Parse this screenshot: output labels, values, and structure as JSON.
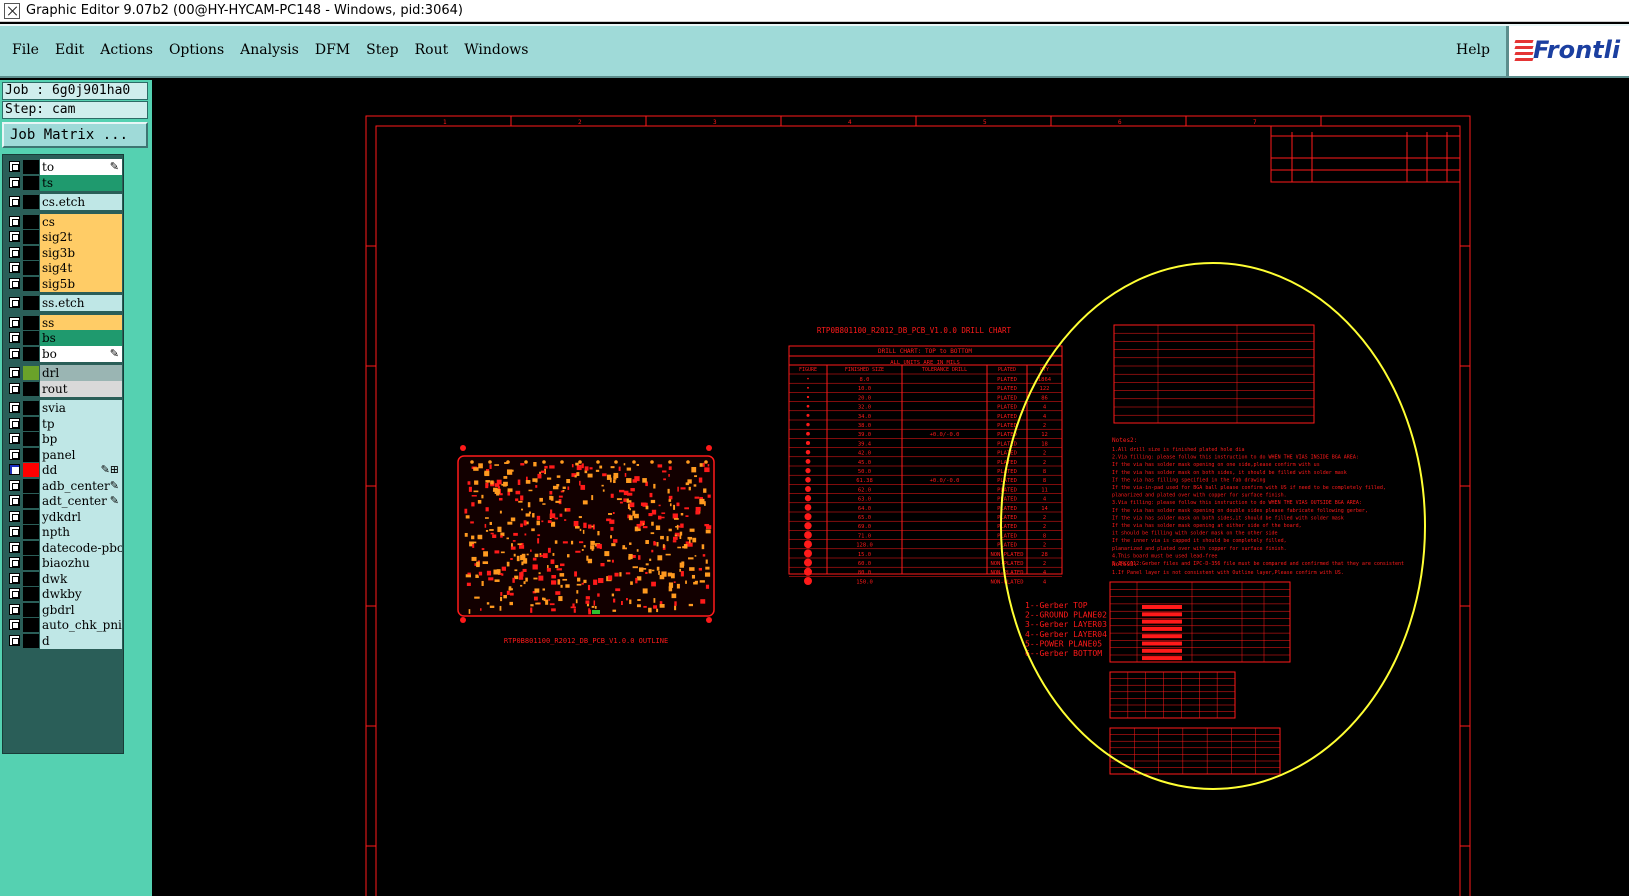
{
  "window": {
    "title": "Graphic Editor 9.07b2 (00@HY-HYCAM-PC148 - Windows, pid:3064)"
  },
  "menubar": {
    "items": [
      "File",
      "Edit",
      "Actions",
      "Options",
      "Analysis",
      "DFM",
      "Step",
      "Rout",
      "Windows"
    ],
    "help_label": "Help",
    "logo_text": "Frontli"
  },
  "job": {
    "label": "Job : 6g0j901ha0",
    "step": "Step: cam",
    "matrix_label": "Job Matrix ..."
  },
  "layers": [
    {
      "name": "to",
      "color": "#ffffff",
      "checked": false,
      "marker": "✎"
    },
    {
      "name": "ts",
      "color": "#1f9a6e",
      "checked": false,
      "marker": ""
    },
    {
      "name": "cs.etch",
      "color": "#bfe7e6",
      "checked": false,
      "marker": "",
      "gap": true
    },
    {
      "name": "cs",
      "color": "#ffcc66",
      "checked": false,
      "marker": "",
      "gap": true
    },
    {
      "name": "sig2t",
      "color": "#ffcc66",
      "checked": false,
      "marker": ""
    },
    {
      "name": "sig3b",
      "color": "#ffcc66",
      "checked": false,
      "marker": ""
    },
    {
      "name": "sig4t",
      "color": "#ffcc66",
      "checked": false,
      "marker": ""
    },
    {
      "name": "sig5b",
      "color": "#ffcc66",
      "checked": false,
      "marker": ""
    },
    {
      "name": "ss.etch",
      "color": "#bfe7e6",
      "checked": false,
      "marker": "",
      "gap": true
    },
    {
      "name": "ss",
      "color": "#ffcc66",
      "checked": false,
      "marker": "",
      "gap": true
    },
    {
      "name": "bs",
      "color": "#1f9a6e",
      "checked": false,
      "marker": ""
    },
    {
      "name": "bo",
      "color": "#ffffff",
      "checked": false,
      "marker": "✎"
    },
    {
      "name": "drl",
      "color": "#9ab5b3",
      "checked": false,
      "marker": "",
      "gap": true,
      "swatch": "#6aa22a"
    },
    {
      "name": "rout",
      "color": "#d9d9d9",
      "checked": false,
      "marker": ""
    },
    {
      "name": "svia",
      "color": "#bfe7e6",
      "checked": false,
      "marker": "",
      "gap": true
    },
    {
      "name": "tp",
      "color": "#bfe7e6",
      "checked": false,
      "marker": ""
    },
    {
      "name": "bp",
      "color": "#bfe7e6",
      "checked": false,
      "marker": ""
    },
    {
      "name": "panel",
      "color": "#bfe7e6",
      "checked": false,
      "marker": ""
    },
    {
      "name": "dd",
      "color": "#bfe7e6",
      "checked": true,
      "marker": "✎⊞",
      "swatch": "#ff0000"
    },
    {
      "name": "adb_center",
      "color": "#bfe7e6",
      "checked": false,
      "marker": "✎"
    },
    {
      "name": "adt_center",
      "color": "#bfe7e6",
      "checked": false,
      "marker": "✎"
    },
    {
      "name": "ydkdrl",
      "color": "#bfe7e6",
      "checked": false,
      "marker": ""
    },
    {
      "name": "npth",
      "color": "#bfe7e6",
      "checked": false,
      "marker": ""
    },
    {
      "name": "datecode-pbc",
      "color": "#bfe7e6",
      "checked": false,
      "marker": ""
    },
    {
      "name": "biaozhu",
      "color": "#bfe7e6",
      "checked": false,
      "marker": ""
    },
    {
      "name": "dwk",
      "color": "#bfe7e6",
      "checked": false,
      "marker": ""
    },
    {
      "name": "dwkby",
      "color": "#bfe7e6",
      "checked": false,
      "marker": ""
    },
    {
      "name": "gbdrl",
      "color": "#bfe7e6",
      "checked": false,
      "marker": ""
    },
    {
      "name": "auto_chk_pni",
      "color": "#bfe7e6",
      "checked": false,
      "marker": ""
    },
    {
      "name": "d",
      "color": "#bfe7e6",
      "checked": false,
      "marker": ""
    }
  ],
  "drawing": {
    "drill_chart_title": "RTP0B801100_R2012_DB_PCB_V1.0.0 DRILL CHART",
    "drill_chart_subtitle": "DRILL CHART: TOP to BOTTOM",
    "drill_units": "ALL UNITS ARE IN MILS",
    "drill_headers": [
      "FIGURE",
      "FINISHED SIZE",
      "TOLERANCE DRILL",
      "PLATED",
      "QTY"
    ],
    "drill_rows": [
      [
        "",
        "8.0",
        "",
        "PLATED",
        "1864"
      ],
      [
        "",
        "10.0",
        "",
        "PLATED",
        "122"
      ],
      [
        "",
        "20.0",
        "",
        "PLATED",
        "86"
      ],
      [
        "",
        "32.0",
        "",
        "PLATED",
        "4"
      ],
      [
        "",
        "34.0",
        "",
        "PLATED",
        "4"
      ],
      [
        "",
        "38.0",
        "",
        "PLATED",
        "2"
      ],
      [
        "",
        "39.0",
        "+0.0/-0.0",
        "PLATED",
        "12"
      ],
      [
        "",
        "39.4",
        "",
        "PLATED",
        "18"
      ],
      [
        "",
        "42.0",
        "",
        "PLATED",
        "2"
      ],
      [
        "",
        "45.0",
        "",
        "PLATED",
        "2"
      ],
      [
        "",
        "50.0",
        "",
        "PLATED",
        "8"
      ],
      [
        "",
        "61.38",
        "+0.0/-0.0",
        "PLATED",
        "8"
      ],
      [
        "",
        "62.0",
        "",
        "PLATED",
        "11"
      ],
      [
        "",
        "63.0",
        "",
        "PLATED",
        "4"
      ],
      [
        "",
        "64.0",
        "",
        "PLATED",
        "14"
      ],
      [
        "",
        "65.0",
        "",
        "PLATED",
        "2"
      ],
      [
        "",
        "69.0",
        "",
        "PLATED",
        "2"
      ],
      [
        "",
        "71.0",
        "",
        "PLATED",
        "8"
      ],
      [
        "",
        "128.0",
        "",
        "PLATED",
        "2"
      ],
      [
        "",
        "15.0",
        "",
        "NON-PLATED",
        "28"
      ],
      [
        "",
        "60.0",
        "",
        "NON-PLATED",
        "2"
      ],
      [
        "",
        "80.0",
        "",
        "NON-PLATED",
        "4"
      ],
      [
        "",
        "150.0",
        "",
        "NON-PLATED",
        "4"
      ]
    ],
    "outline_label": "RTP0B801100_R2012_DB_PCB_V1.0.0 OUTLINE",
    "stackup_layers": [
      "1--Gerber TOP",
      "2--GROUND PLANE02",
      "3--Gerber LAYER03",
      "4--Gerber LAYER04",
      "5--POWER PLANE05",
      "6--Gerber BOTTOM"
    ],
    "notes_title": "Notes2:",
    "notes_lines": [
      "1.All drill size is finished plated hole dia",
      "2.Via filling: please follow this instruction to do WHEN THE VIAS INSIDE BGA AREA:",
      "   If the via has solder mask opening on one side,please confirm with us",
      "   If the via has solder mask on both sides, it should be filled with solder mask",
      "   If the via has filling specified in the fab drawing",
      "   If the via-in-pad used for BGA ball please confirm with US if need to be completely filled,",
      "   planarized and plated over with copper for surface finish.",
      "3.Via filling: please follow this instruction to do WHEN THE VIAS OUTSIDE BGA AREA:",
      "   If the via has solder mask opening on double sides please fabricate following gerber,",
      "   If the via has solder mask on both sides,it should be filled with solder mask",
      "   If the via has solder mask opening at either side of the board,",
      "   it should be filling with solder mask on the other side",
      "   If the inner via is capped it should be completely filled,",
      "   planarized and plated over with copper for surface finish.",
      "4.This board must be used lead-free",
      "5.IPC6012:Gerber files and IPC-D-356 file must be compared and confirmed that they are consistent"
    ],
    "notes3_title": "Notes3:",
    "notes3_line": "1.If Panel layer is not consistent with Outline layer,Please confirm with US."
  },
  "colors": {
    "canvas_bg": "#000000",
    "drawing_red": "#ff1a1a",
    "highlight_ellipse": "#ffff33",
    "pad_orange": "#ff9a1f"
  }
}
